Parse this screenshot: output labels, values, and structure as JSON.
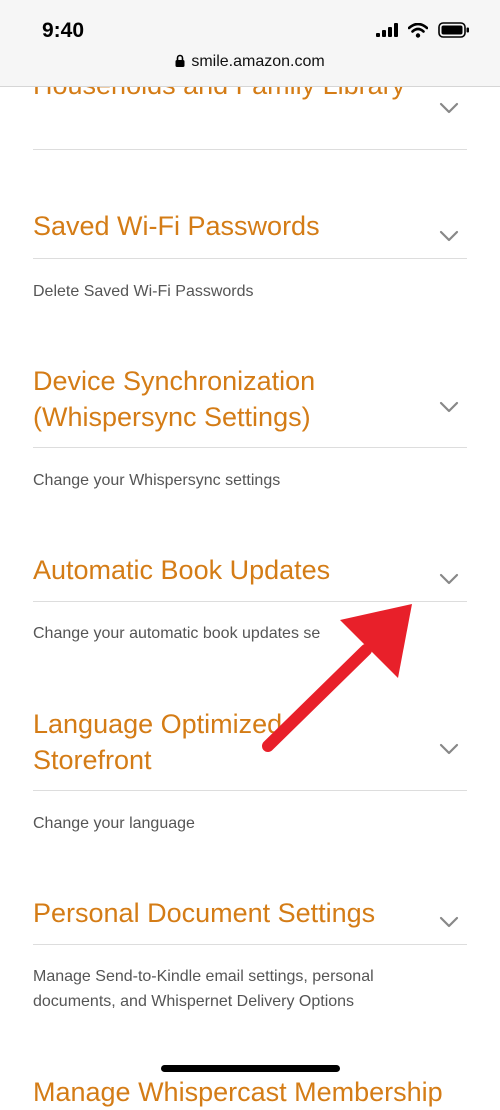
{
  "status": {
    "time": "9:40",
    "url": "smile.amazon.com",
    "icons": [
      "cellular-signal-icon",
      "wifi-icon",
      "battery-icon"
    ]
  },
  "sections": [
    {
      "title": "Households and Family Library",
      "subtitle": "",
      "chevron": "chevron-down-icon"
    },
    {
      "title": "Saved Wi-Fi Passwords",
      "subtitle": "Delete Saved Wi-Fi Passwords",
      "chevron": "chevron-down-icon"
    },
    {
      "title": "Device Synchronization (Whispersync Settings)",
      "subtitle": "Change your Whispersync settings",
      "chevron": "chevron-down-icon"
    },
    {
      "title": "Automatic Book Updates",
      "subtitle": "Change your automatic book updates se",
      "chevron": "chevron-down-icon"
    },
    {
      "title": "Language Optimized Storefront",
      "subtitle": "Change your language",
      "chevron": "chevron-down-icon"
    },
    {
      "title": "Personal Document Settings",
      "subtitle": "Manage Send-to-Kindle email settings, personal documents, and Whispernet Delivery Options",
      "chevron": "chevron-down-icon"
    },
    {
      "title": "Manage Whispercast Membership",
      "subtitle": "",
      "chevron": "chevron-down-icon"
    }
  ],
  "colors": {
    "accent": "#d47c16",
    "annotation_arrow": "#e8202a"
  }
}
